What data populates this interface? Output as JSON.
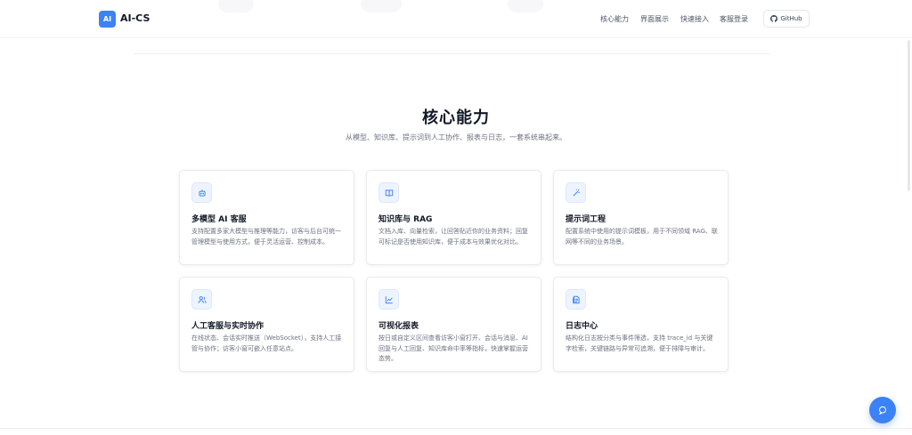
{
  "header": {
    "logo_text": "AI",
    "brand": "AI-CS",
    "nav": [
      "核心能力",
      "界面展示",
      "快速接入",
      "客服登录"
    ],
    "github_label": "GitHub"
  },
  "section": {
    "title": "核心能力",
    "subtitle": "从模型、知识库、提示词到人工协作、报表与日志，一套系统串起来。"
  },
  "features": [
    {
      "icon": "robot-icon",
      "title": "多模型 AI 客服",
      "desc": "支持配置多家大模型与推理等能力，访客与后台可统一管理模型与使用方式，便于灵活运营、控制成本。"
    },
    {
      "icon": "book-icon",
      "title": "知识库与 RAG",
      "desc": "文档入库、向量检索，让回答贴近你的业务资料；回复可标记是否使用知识库，便于成本与效果优化对比。"
    },
    {
      "icon": "magic-wand-icon",
      "title": "提示词工程",
      "desc": "配置系统中使用的提示词模板，用于不同领域 RAG、联网等不同的业务场景。"
    },
    {
      "icon": "users-icon",
      "title": "人工客服与实时协作",
      "desc": "在线状态、会话实时推送（WebSocket），支持人工接管与协作；访客小窗可嵌入任意站点。"
    },
    {
      "icon": "chart-icon",
      "title": "可视化报表",
      "desc": "按日或自定义区间查看访客小窗打开、会话与消息、AI 回复与人工回复、知识库命中率等指标，快速掌握运营态势。"
    },
    {
      "icon": "log-icon",
      "title": "日志中心",
      "desc": "结构化日志按分类与事件筛选，支持 trace_id 与关键字检索，关键链路与异常可追溯，便于排障与审计。"
    }
  ],
  "colors": {
    "accent": "#3b82f6",
    "icon_bg": "#eef4ff"
  }
}
